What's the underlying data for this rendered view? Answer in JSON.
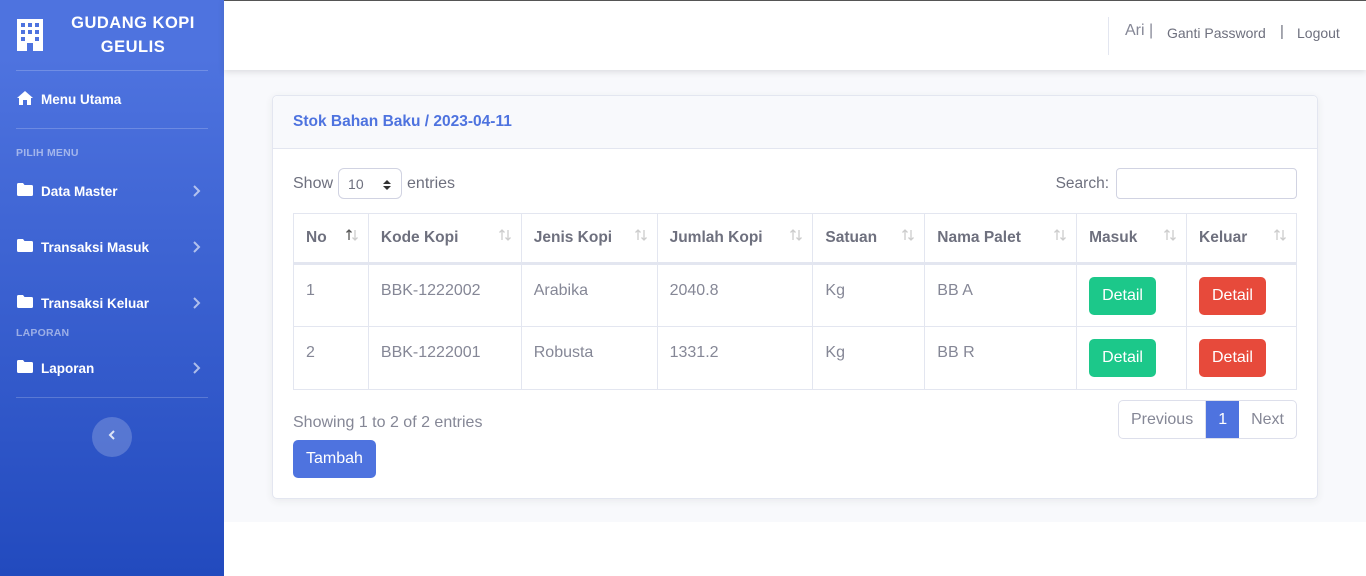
{
  "brand": {
    "line1": "GUDANG KOPI",
    "line2": "GEULIS"
  },
  "sidebar": {
    "home_label": "Menu Utama",
    "heading_menu": "PILIH MENU",
    "items": [
      {
        "label": "Data Master",
        "icon": "folder-icon"
      },
      {
        "label": "Transaksi Masuk",
        "icon": "folder-icon"
      },
      {
        "label": "Transaksi Keluar",
        "icon": "folder-icon"
      }
    ],
    "heading_report": "LAPORAN",
    "report_item": {
      "label": "Laporan",
      "icon": "folder-icon"
    }
  },
  "topbar": {
    "user": "Ari |",
    "change_password": "Ganti Password",
    "separator": "|",
    "logout": "Logout"
  },
  "card": {
    "title": "Stok Bahan Baku / 2023-04-11"
  },
  "table_controls": {
    "show_label": "Show",
    "entries_label": "entries",
    "length_value": "10",
    "search_label": "Search:",
    "search_value": ""
  },
  "table": {
    "headers": [
      "No",
      "Kode Kopi",
      "Jenis Kopi",
      "Jumlah Kopi",
      "Satuan",
      "Nama Palet",
      "Masuk",
      "Keluar"
    ],
    "rows": [
      {
        "no": "1",
        "kode": "BBK-1222002",
        "jenis": "Arabika",
        "jumlah": "2040.8",
        "satuan": "Kg",
        "palet": "BB A",
        "masuk": "Detail",
        "keluar": "Detail"
      },
      {
        "no": "2",
        "kode": "BBK-1222001",
        "jenis": "Robusta",
        "jumlah": "1331.2",
        "satuan": "Kg",
        "palet": "BB R",
        "masuk": "Detail",
        "keluar": "Detail"
      }
    ]
  },
  "footer": {
    "info": "Showing 1 to 2 of 2 entries",
    "prev": "Previous",
    "page": "1",
    "next": "Next",
    "add_button": "Tambah"
  },
  "colors": {
    "primary": "#4e73df",
    "success": "#1cc88a",
    "danger": "#e74a3b"
  }
}
